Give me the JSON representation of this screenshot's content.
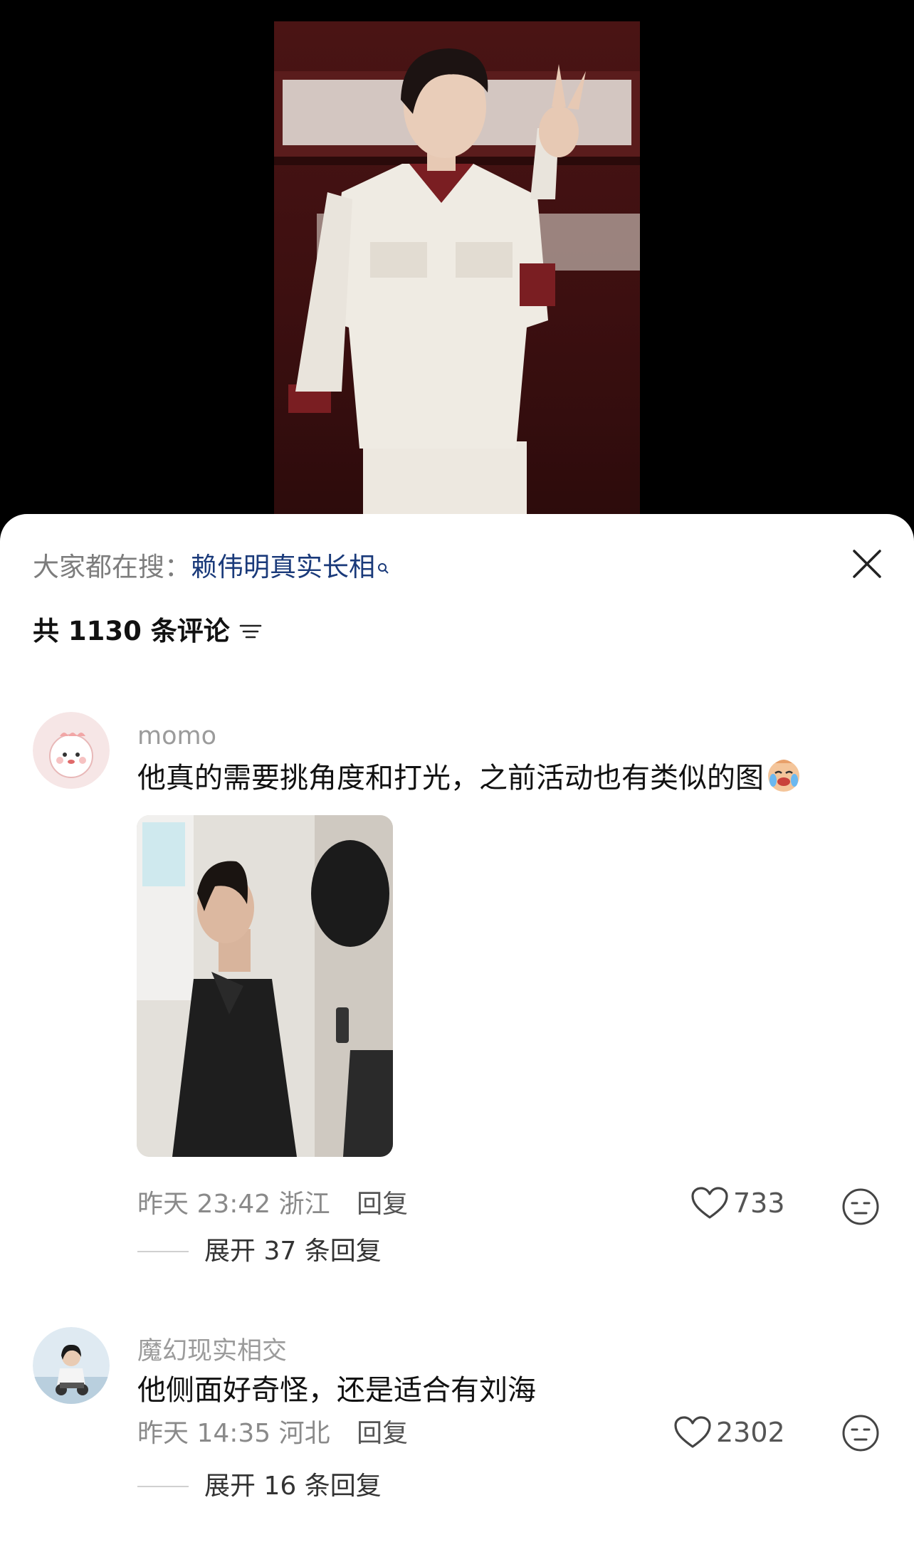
{
  "hot_search": {
    "label": "大家都在搜：",
    "term": "赖伟明真实长相"
  },
  "comments_header": {
    "count_text": "共 1130 条评论"
  },
  "comments": [
    {
      "username": "momo",
      "text": "他真的需要挑角度和打光，之前活动也有类似的图",
      "time": "昨天 23:42",
      "location": "浙江",
      "reply_label": "回复",
      "likes": "733",
      "expand_text": "展开 37 条回复"
    },
    {
      "username": "魔幻现实相交",
      "text": "他侧面好奇怪，还是适合有刘海",
      "time": "昨天 14:35",
      "location": "河北",
      "reply_label": "回复",
      "likes": "2302",
      "expand_text": "展开 16 条回复"
    }
  ],
  "icons": {
    "close": "close-icon",
    "sort": "filter-lines-icon",
    "like": "heart-outline-icon",
    "react": "neutral-face-icon",
    "search_hint": "magnifier-icon",
    "crying_emoji": "crying-laughing-emoji-icon"
  },
  "colors": {
    "hot_search_term": "#1a3a7a",
    "muted_text": "#8a8a8a",
    "sheet_bg": "#ffffff",
    "page_bg": "#000000"
  }
}
